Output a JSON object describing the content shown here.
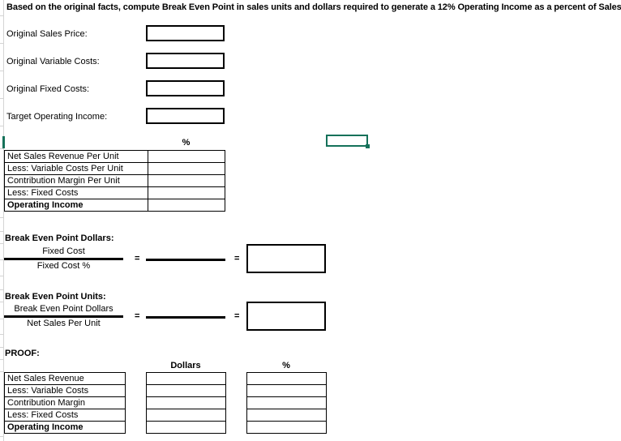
{
  "document": {
    "title": "Based on the original facts, compute Break Even Point in sales units and dollars required to generate a 12% Operating Income as a percent of Sales."
  },
  "inputs": {
    "fields": [
      {
        "label": "Original Sales Price:",
        "value": ""
      },
      {
        "label": "Original Variable Costs:",
        "value": ""
      },
      {
        "label": "Original Fixed Costs:",
        "value": ""
      },
      {
        "label": "Target Operating Income:",
        "value": ""
      }
    ]
  },
  "per_unit_table": {
    "percent_header": "%",
    "rows": [
      {
        "label": "Net Sales Revenue Per Unit",
        "value": ""
      },
      {
        "label": "Less:  Variable Costs Per Unit",
        "value": ""
      },
      {
        "label": "Contribution Margin Per Unit",
        "value": ""
      },
      {
        "label": "Less:  Fixed Costs",
        "value": ""
      },
      {
        "label": "Operating Income",
        "value": ""
      }
    ]
  },
  "break_even_dollars": {
    "heading": "Break Even Point Dollars:",
    "numerator": "Fixed Cost",
    "denominator": "Fixed Cost %",
    "equals_1": "=",
    "equals_2": "=",
    "result": ""
  },
  "break_even_units": {
    "heading": "Break Even Point Units:",
    "numerator": "Break Even Point Dollars",
    "denominator": "Net Sales Per Unit",
    "equals_1": "=",
    "equals_2": "=",
    "result": ""
  },
  "proof": {
    "heading": "PROOF:",
    "col_dollars": "Dollars",
    "col_percent": "%",
    "rows": [
      {
        "label": "Net Sales Revenue",
        "dollars": "",
        "percent": ""
      },
      {
        "label": "Less:  Variable Costs",
        "dollars": "",
        "percent": ""
      },
      {
        "label": "Contribution Margin",
        "dollars": "",
        "percent": ""
      },
      {
        "label": "Less:  Fixed Costs",
        "dollars": "",
        "percent": ""
      },
      {
        "label": "Operating Income",
        "dollars": "",
        "percent": ""
      }
    ]
  },
  "selection": {
    "active_cell_border_color": "#15715a",
    "fill_handle_color": "#15715a"
  },
  "colors": {
    "background": "#ffffff",
    "text": "#000000",
    "gridline": "#d4d4d4",
    "box_border": "#000000",
    "selection_green": "#15715a"
  }
}
